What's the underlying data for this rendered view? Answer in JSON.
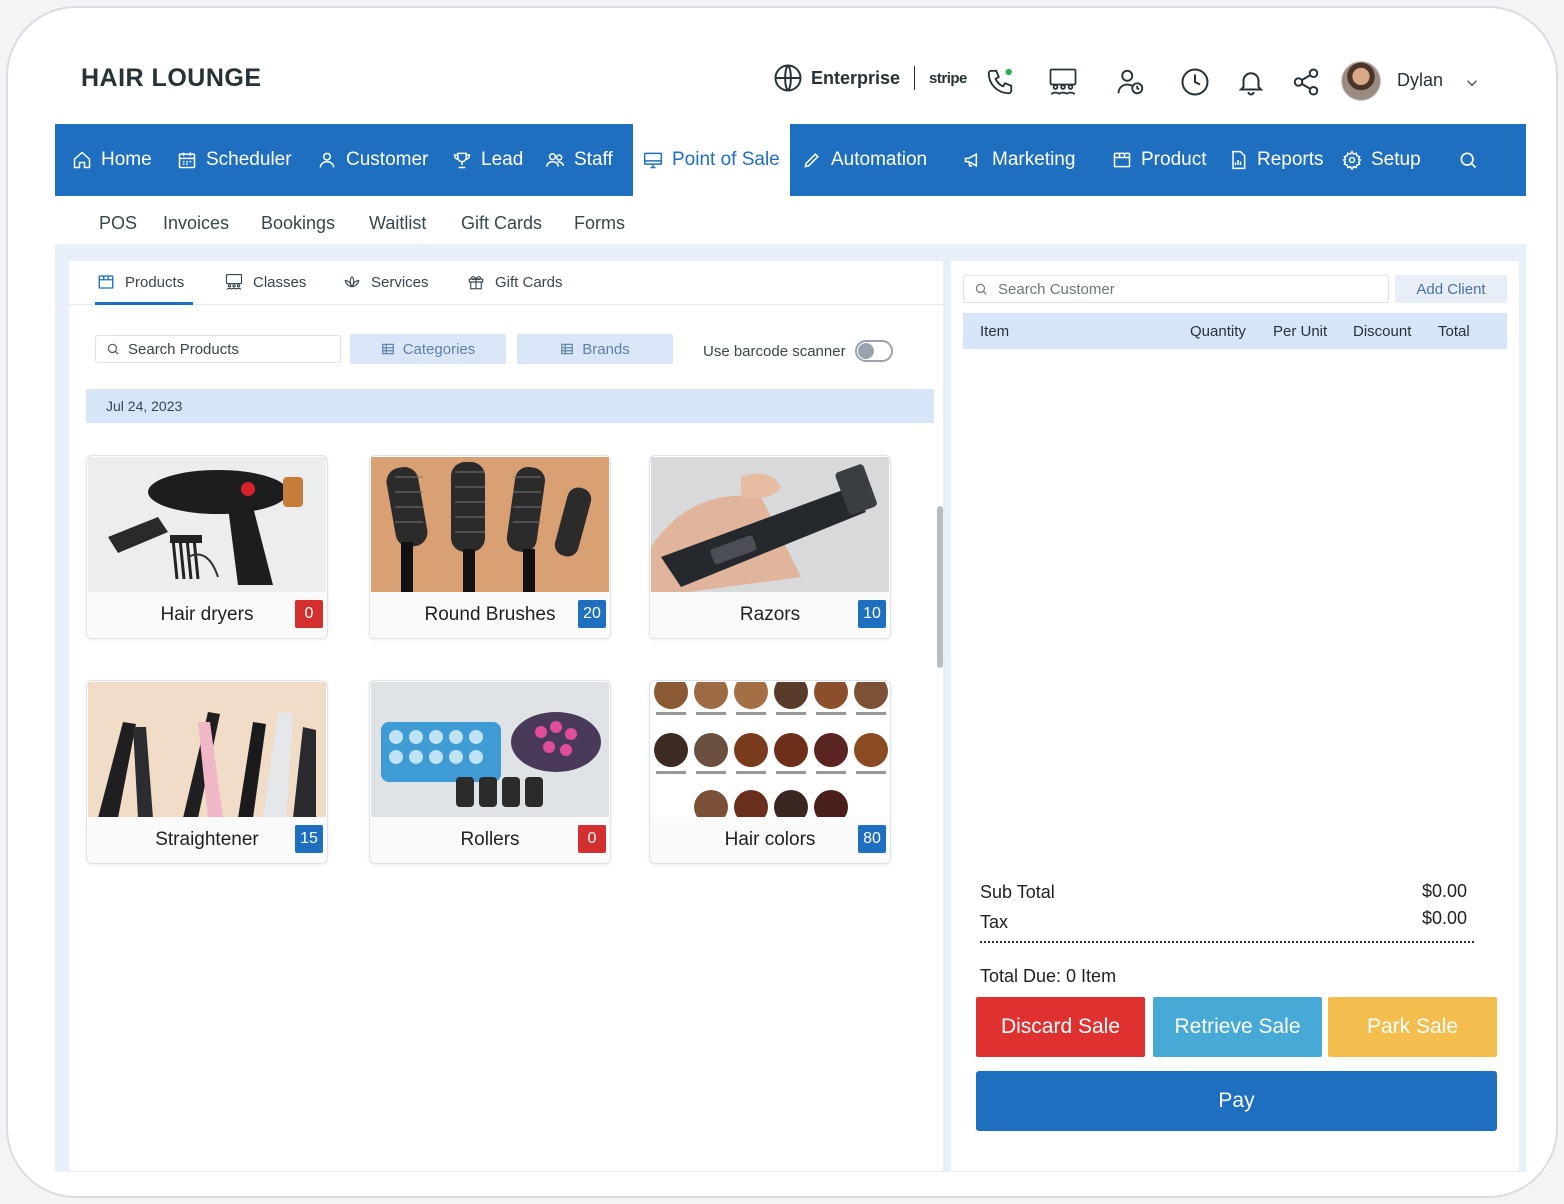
{
  "header": {
    "brand": "HAIR LOUNGE",
    "plan": "Enterprise",
    "payment_provider": "stripe",
    "user_name": "Dylan"
  },
  "main_nav": [
    {
      "label": "Home",
      "icon": "home-icon"
    },
    {
      "label": "Scheduler",
      "icon": "calendar-icon"
    },
    {
      "label": "Customer",
      "icon": "user-icon"
    },
    {
      "label": "Lead",
      "icon": "trophy-icon"
    },
    {
      "label": "Staff",
      "icon": "users-icon"
    },
    {
      "label": "Point of Sale",
      "icon": "monitor-icon",
      "active": true
    },
    {
      "label": "Automation",
      "icon": "pencil-icon"
    },
    {
      "label": "Marketing",
      "icon": "megaphone-icon"
    },
    {
      "label": "Product",
      "icon": "box-icon"
    },
    {
      "label": "Reports",
      "icon": "report-icon"
    },
    {
      "label": "Setup",
      "icon": "gear-icon"
    }
  ],
  "sub_nav": [
    "POS",
    "Invoices",
    "Bookings",
    "Waitlist",
    "Gift Cards",
    "Forms"
  ],
  "tabs": [
    {
      "label": "Products",
      "active": true
    },
    {
      "label": "Classes"
    },
    {
      "label": "Services"
    },
    {
      "label": "Gift Cards"
    }
  ],
  "filters": {
    "search_placeholder": "Search Products",
    "categories": "Categories",
    "brands": "Brands",
    "barcode_label": "Use barcode scanner",
    "barcode_enabled": false
  },
  "date": "Jul 24, 2023",
  "products": [
    {
      "name": "Hair dryers",
      "count": "0",
      "badge_color": "#d32f2f"
    },
    {
      "name": "Round Brushes",
      "count": "20",
      "badge_color": "#1f6fc0"
    },
    {
      "name": "Razors",
      "count": "10",
      "badge_color": "#1f6fc0"
    },
    {
      "name": "Straightener",
      "count": "15",
      "badge_color": "#1f6fc0"
    },
    {
      "name": "Rollers",
      "count": "0",
      "badge_color": "#d32f2f"
    },
    {
      "name": "Hair colors",
      "count": "80",
      "badge_color": "#1f6fc0"
    }
  ],
  "cart": {
    "search_placeholder": "Search Customer",
    "add_client": "Add Client",
    "columns": [
      "Item",
      "Quantity",
      "Per Unit",
      "Discount",
      "Total"
    ],
    "sub_total_label": "Sub Total",
    "sub_total": "$0.00",
    "tax_label": "Tax",
    "tax": "$0.00",
    "total_due": "Total Due: 0 Item"
  },
  "actions": {
    "discard": "Discard Sale",
    "retrieve": "Retrieve Sale",
    "park": "Park Sale",
    "pay": "Pay"
  },
  "colors": {
    "primary": "#1f6fc0",
    "discard": "#e03131",
    "retrieve": "#46a9d6",
    "park": "#f4be4f"
  }
}
